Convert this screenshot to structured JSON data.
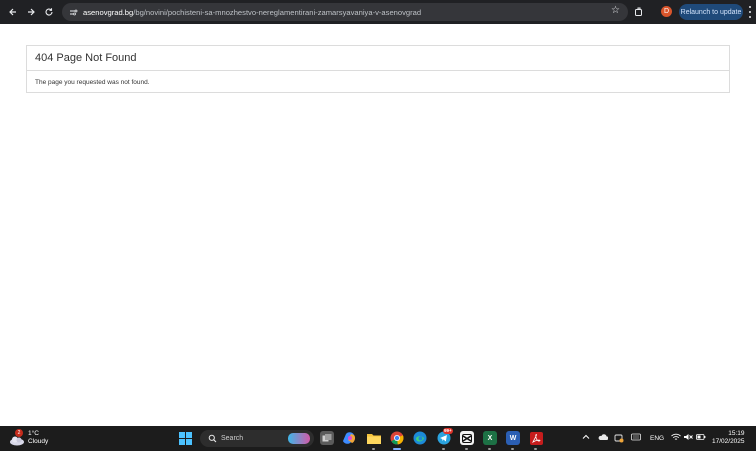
{
  "browser": {
    "url_host": "asenovgrad.bg",
    "url_path": "/bg/novini/pochisteni-sa-mnozhestvo-nereglamentirani-zamarsyavaniya-v-asenovgrad",
    "relaunch_label": "Relaunch to update",
    "profile_initial": "D"
  },
  "page": {
    "heading": "404 Page Not Found",
    "message": "The page you requested was not found."
  },
  "taskbar": {
    "weather_temp": "1°C",
    "weather_desc": "Cloudy",
    "weather_badge": "2",
    "search_label": "Search",
    "telegram_badge": "99+",
    "language": "ENG",
    "time": "15:19",
    "date": "17/02/2025"
  },
  "colors": {
    "chrome_toolbar": "#202124",
    "relaunch_button": "#1f4a7a",
    "taskbar": "#1c1c1c",
    "windows_accent": "#4cc2ff"
  }
}
